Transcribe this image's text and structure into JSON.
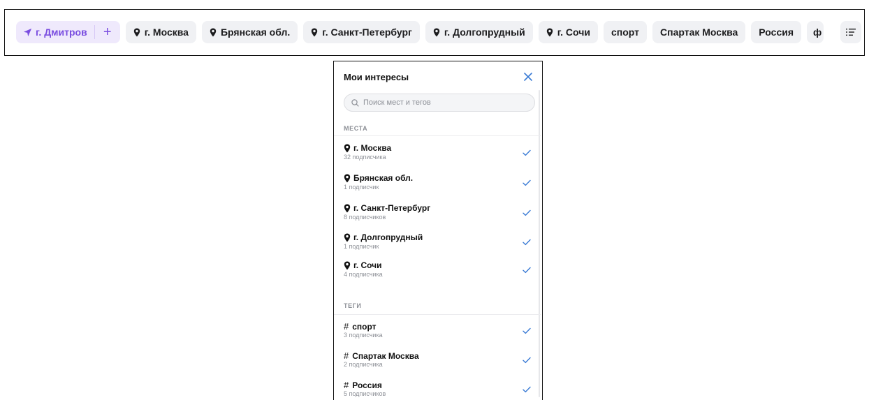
{
  "topbar": {
    "current_location": "г. Дмитров",
    "add_label": "+",
    "chips": [
      {
        "label": "г. Москва",
        "icon": "pin-icon"
      },
      {
        "label": "Брянская обл.",
        "icon": "pin-icon"
      },
      {
        "label": "г. Санкт-Петербург",
        "icon": "pin-icon"
      },
      {
        "label": "г. Долгопрудный",
        "icon": "pin-icon"
      },
      {
        "label": "г. Сочи",
        "icon": "pin-icon"
      },
      {
        "label": "спорт",
        "icon": ""
      },
      {
        "label": "Спартак Москва",
        "icon": ""
      },
      {
        "label": "Россия",
        "icon": ""
      },
      {
        "label": "ф",
        "icon": ""
      }
    ],
    "menu_icon": "list-icon"
  },
  "panel": {
    "title": "Мои интересы",
    "search_placeholder": "Поиск мест и тегов",
    "places_header": "МЕСТА",
    "tags_header": "ТЕГИ",
    "places": [
      {
        "name": "г. Москва",
        "subscribers": "32 подписчика"
      },
      {
        "name": "Брянская обл.",
        "subscribers": "1 подписчик"
      },
      {
        "name": "г. Санкт-Петербург",
        "subscribers": "8 подписчиков"
      },
      {
        "name": "г. Долгопрудный",
        "subscribers": "1 подписчик"
      },
      {
        "name": "г. Сочи",
        "subscribers": "4 подписчика"
      }
    ],
    "tags": [
      {
        "hash": "#",
        "name": "спорт",
        "subscribers": "3 подписчика"
      },
      {
        "hash": "#",
        "name": "Спартак Москва",
        "subscribers": "2 подписчика"
      },
      {
        "hash": "#",
        "name": "Россия",
        "subscribers": "5 подписчиков"
      }
    ]
  },
  "colors": {
    "accent": "#7a4de0",
    "check": "#3a7bd5",
    "close": "#3a7bd5"
  }
}
